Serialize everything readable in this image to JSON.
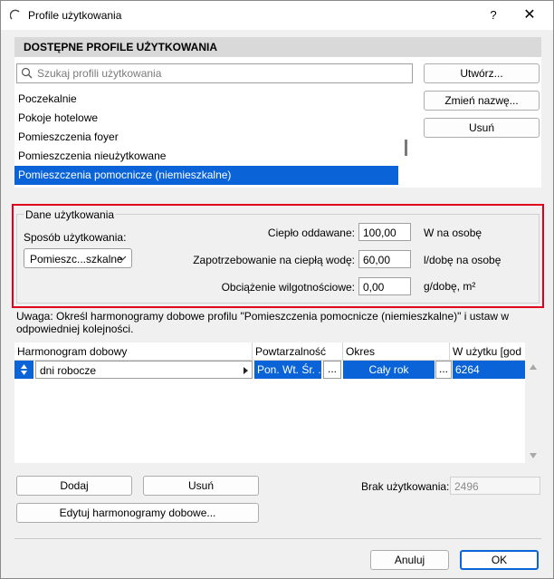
{
  "window": {
    "title": "Profile użytkowania",
    "help_label": "?",
    "close_label": "✕"
  },
  "profiles_section": {
    "header": "DOSTĘPNE PROFILE UŻYTKOWANIA",
    "search_placeholder": "Szukaj profili użytkowania",
    "items": [
      "Poczekalnie",
      "Pokoje hotelowe",
      "Pomieszczenia foyer",
      "Pomieszczenia nieużytkowane",
      "Pomieszczenia pomocnicze (niemieszkalne)"
    ],
    "selected_index": 4,
    "buttons": {
      "create": "Utwórz...",
      "rename": "Zmień nazwę...",
      "delete": "Usuń"
    }
  },
  "usage_data": {
    "legend": "Dane użytkowania",
    "mode_label": "Sposób użytkowania:",
    "mode_value": "Pomieszc...szkalne",
    "heat_label": "Ciepło oddawane:",
    "heat_value": "100,00",
    "heat_unit": "W na osobę",
    "hot_water_label": "Zapotrzebowanie na ciepłą wodę:",
    "hot_water_value": "60,00",
    "hot_water_unit": "l/dobę na osobę",
    "humidity_label": "Obciążenie wilgotnościowe:",
    "humidity_value": "0,00",
    "humidity_unit": "g/dobę, m²"
  },
  "note": "Uwaga: Określ harmonogramy dobowe profilu \"Pomieszczenia pomocnicze (niemieszkalne)\" i ustaw w odpowiedniej kolejności.",
  "schedule_table": {
    "columns": [
      "Harmonogram dobowy",
      "Powtarzalność",
      "Okres",
      "W użytku [god"
    ],
    "rows": [
      {
        "name": "dni robocze",
        "repeat": "Pon. Wt. Śr. ...",
        "period": "Cały rok",
        "hours": "6264"
      }
    ],
    "more_label": "..."
  },
  "bottom": {
    "add": "Dodaj",
    "remove": "Usuń",
    "edit_schedules": "Edytuj harmonogramy dobowe...",
    "unused_label": "Brak użytkowania:",
    "unused_value": "2496"
  },
  "footer": {
    "cancel": "Anuluj",
    "ok": "OK"
  },
  "colors": {
    "selection": "#0a64d8",
    "highlight_border": "#e0001b",
    "ok_border": "#0a64d8"
  }
}
